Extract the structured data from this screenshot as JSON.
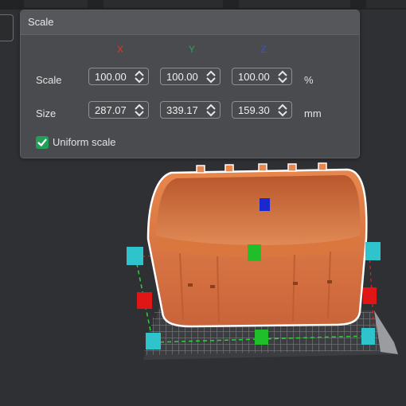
{
  "panel": {
    "title": "Scale",
    "axes": {
      "x": "X",
      "y": "Y",
      "z": "Z"
    },
    "scale": {
      "label": "Scale",
      "x": "100.00",
      "y": "100.00",
      "z": "100.00",
      "unit": "%"
    },
    "size": {
      "label": "Size",
      "x": "287.07",
      "y": "339.17",
      "z": "159.30",
      "unit": "mm"
    },
    "uniform_scale": {
      "label": "Uniform scale",
      "checked": true
    }
  },
  "colors": {
    "panel_bg": "#4a4b4e",
    "model": "#e07a44",
    "handle_x": "#e01515",
    "handle_y": "#1fbf2c",
    "handle_z": "#1b27cf",
    "handle_corner": "#2fc3cc",
    "checkbox": "#22a05a"
  },
  "icons": [
    "spin-arrows-icon",
    "checkmark-icon"
  ]
}
